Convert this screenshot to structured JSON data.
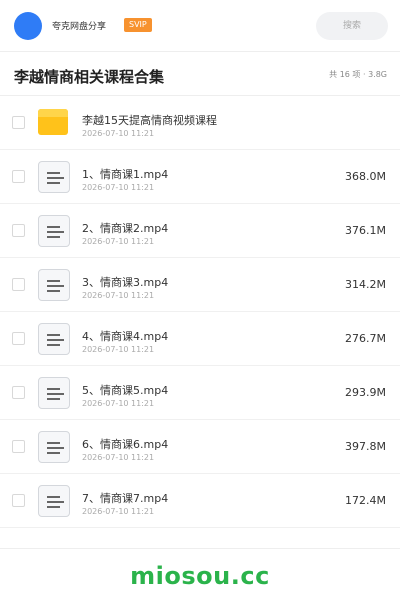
{
  "header": {
    "app_name": "夸克网盘分享",
    "badge": "SVIP",
    "search_placeholder": "搜索",
    "avatar_color": "#2f7cf6",
    "badge_color": "#f7922f"
  },
  "page": {
    "title": "李越情商相关课程合集",
    "summary": "共 16 项 · 3.8G"
  },
  "items": [
    {
      "name": "李越15天提高情商视频课程",
      "date": "2026-07-10 11:21",
      "size": "",
      "icon": "folder-icon"
    },
    {
      "name": "1、情商课1.mp4",
      "date": "2026-07-10 11:21",
      "size": "368.0M",
      "icon": "file-icon"
    },
    {
      "name": "2、情商课2.mp4",
      "date": "2026-07-10 11:21",
      "size": "376.1M",
      "icon": "file-icon"
    },
    {
      "name": "3、情商课3.mp4",
      "date": "2026-07-10 11:21",
      "size": "314.2M",
      "icon": "file-icon"
    },
    {
      "name": "4、情商课4.mp4",
      "date": "2026-07-10 11:21",
      "size": "276.7M",
      "icon": "file-icon"
    },
    {
      "name": "5、情商课5.mp4",
      "date": "2026-07-10 11:21",
      "size": "293.9M",
      "icon": "file-icon"
    },
    {
      "name": "6、情商课6.mp4",
      "date": "2026-07-10 11:21",
      "size": "397.8M",
      "icon": "file-icon"
    },
    {
      "name": "7、情商课7.mp4",
      "date": "2026-07-10 11:21",
      "size": "172.4M",
      "icon": "file-icon"
    }
  ],
  "watermark": {
    "text": "miosou.cc",
    "color": "#2bb34b"
  }
}
